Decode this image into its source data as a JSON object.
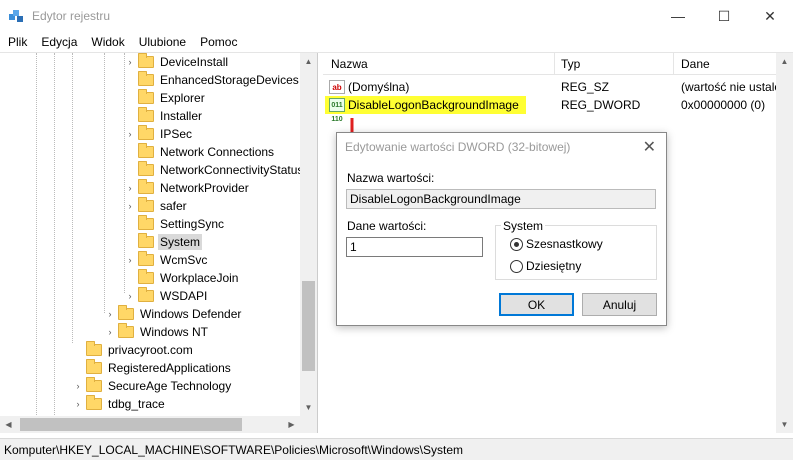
{
  "window": {
    "title": "Edytor rejestru",
    "minimize_glyph": "—",
    "maximize_glyph": "☐",
    "close_glyph": "✕"
  },
  "menu": [
    "Plik",
    "Edycja",
    "Widok",
    "Ulubione",
    "Pomoc"
  ],
  "tree": {
    "items": [
      {
        "label": "DeviceInstall",
        "expander": "›",
        "depth": 2
      },
      {
        "label": "EnhancedStorageDevices",
        "expander": "",
        "depth": 2
      },
      {
        "label": "Explorer",
        "expander": "",
        "depth": 2
      },
      {
        "label": "Installer",
        "expander": "",
        "depth": 2
      },
      {
        "label": "IPSec",
        "expander": "›",
        "depth": 2
      },
      {
        "label": "Network Connections",
        "expander": "",
        "depth": 2
      },
      {
        "label": "NetworkConnectivityStatusIndicator",
        "expander": "",
        "depth": 2
      },
      {
        "label": "NetworkProvider",
        "expander": "›",
        "depth": 2
      },
      {
        "label": "safer",
        "expander": "›",
        "depth": 2
      },
      {
        "label": "SettingSync",
        "expander": "",
        "depth": 2
      },
      {
        "label": "System",
        "expander": "",
        "depth": 2,
        "selected": true
      },
      {
        "label": "WcmSvc",
        "expander": "›",
        "depth": 2
      },
      {
        "label": "WorkplaceJoin",
        "expander": "",
        "depth": 2
      },
      {
        "label": "WSDAPI",
        "expander": "›",
        "depth": 2
      },
      {
        "label": "Windows Defender",
        "expander": "›",
        "depth": 1
      },
      {
        "label": "Windows NT",
        "expander": "›",
        "depth": 1
      },
      {
        "label": "privacyroot.com",
        "expander": "",
        "depth": 0
      },
      {
        "label": "RegisteredApplications",
        "expander": "",
        "depth": 0
      },
      {
        "label": "SecureAge Technology",
        "expander": "›",
        "depth": 0
      },
      {
        "label": "tdbg_trace",
        "expander": "›",
        "depth": 0
      }
    ]
  },
  "list": {
    "columns": [
      "Nazwa",
      "Typ",
      "Dane"
    ],
    "rows": [
      {
        "name": "(Domyślna)",
        "type": "REG_SZ",
        "data": "(wartość nie ustalona)",
        "icon": "ab",
        "icon_name": "string-value-icon"
      },
      {
        "name": "DisableLogonBackgroundImage",
        "type": "REG_DWORD",
        "data": "0x00000000 (0)",
        "icon": "011 110",
        "icon_name": "dword-value-icon",
        "highlighted": true
      }
    ]
  },
  "status": {
    "path": "Komputer\\HKEY_LOCAL_MACHINE\\SOFTWARE\\Policies\\Microsoft\\Windows\\System"
  },
  "dialog": {
    "title": "Edytowanie wartości DWORD (32-bitowej)",
    "name_label": "Nazwa wartości:",
    "name_value": "DisableLogonBackgroundImage",
    "data_label": "Dane wartości:",
    "data_value": "1",
    "base_group": "System",
    "base_hex": "Szesnastkowy",
    "base_dec": "Dziesiętny",
    "base_selected": "hex",
    "ok_label": "OK",
    "cancel_label": "Anuluj",
    "close_glyph": "✕"
  },
  "colors": {
    "highlight": "#ffff33",
    "annotation_arrow": "#e02020",
    "folder": "#ffd767",
    "selection": "#d9d9d9"
  }
}
